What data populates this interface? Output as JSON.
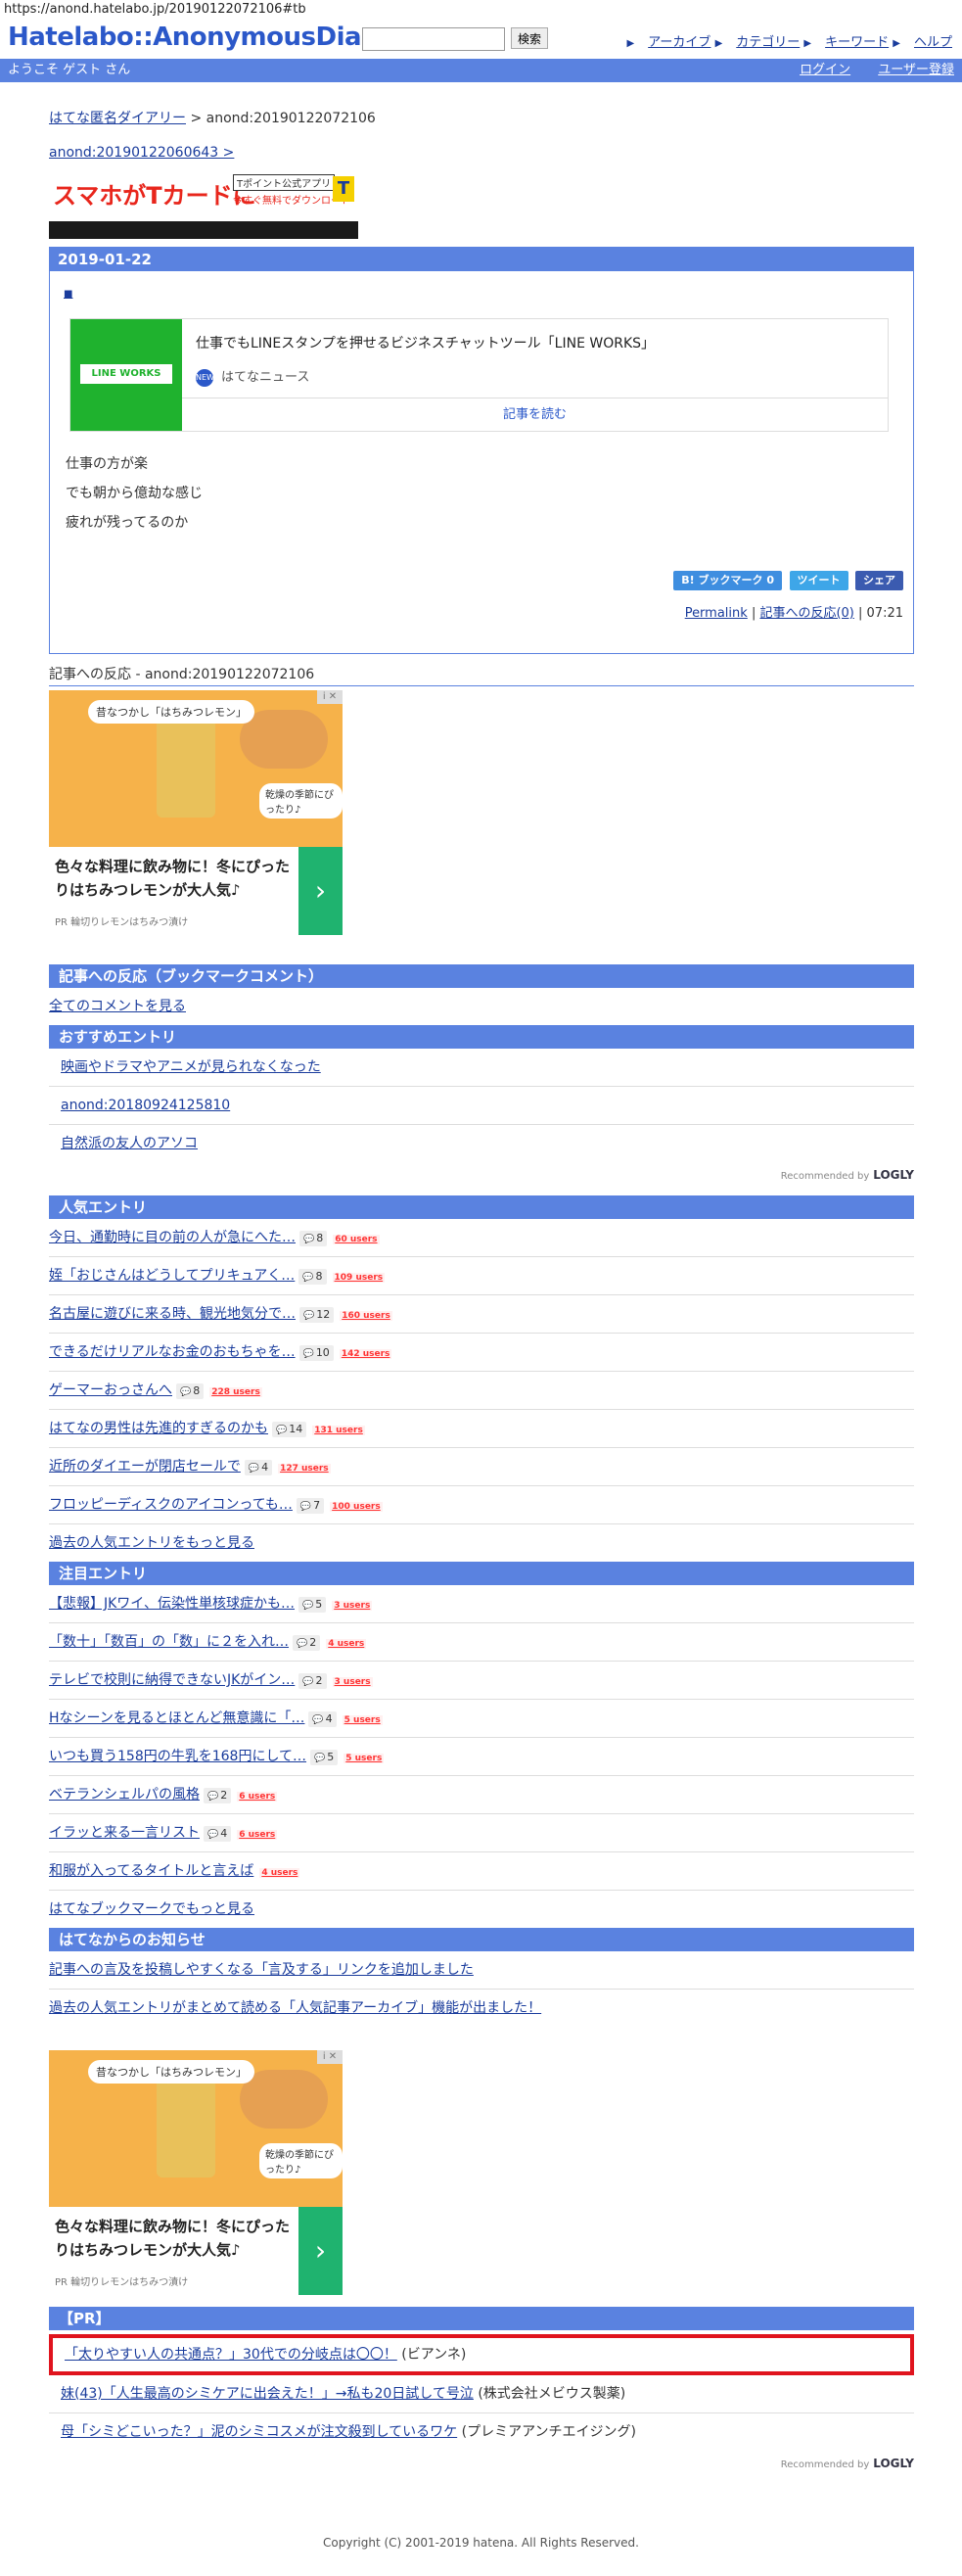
{
  "url": "https://anond.hatelabo.jp/20190122072106#tb",
  "header": {
    "logo": "Hatelabo::AnonymousDiary",
    "search_button": "検索",
    "links": [
      "アーカイブ",
      "カテゴリー",
      "キーワード",
      "ヘルプ"
    ]
  },
  "userbar": {
    "welcome": "ようこそ ゲスト さん",
    "login": "ログイン",
    "register": "ユーザー登録"
  },
  "breadcrumb": {
    "home": "はてな匿名ダイアリー",
    "current": " > anond:20190122072106"
  },
  "prev_link": "anond:20190122060643 >",
  "banner": {
    "text": "スマホがTカードに",
    "badge": "Tポイント公式アプリ",
    "badge2": "今すぐ無料でダウンロード",
    "tlogo": "T"
  },
  "entry": {
    "date": "2019-01-22",
    "small_link": "■",
    "card": {
      "thumb_text": "LINE WORKS",
      "title": "仕事でもLINEスタンプを押せるビジネスチャットツール「LINE WORKS」",
      "source": "はてなニュース",
      "source_icon": "NEW",
      "read": "記事を読む"
    },
    "lines": [
      "仕事の方が楽",
      "でも朝から億劫な感じ",
      "疲れが残ってるのか"
    ],
    "share": {
      "bookmark": "B! ブックマーク  0",
      "tweet": "ツイート",
      "facebook": "シェア"
    },
    "permalink": "Permalink",
    "reactions": "記事への反応(0)",
    "time": " | 07:21"
  },
  "response_title": "記事への反応 - anond:20190122072106",
  "ad": {
    "bubble1": "昔なつかし「はちみつレモン」",
    "bubble2": "乾燥の季節にぴったり♪",
    "text": "色々な料理に飲み物に！冬にぴったりはちみつレモンが大人気♪",
    "advertiser": "PR 輪切りレモンはちみつ漬け",
    "arrow": "›",
    "close": "i ✕"
  },
  "bookmark_section": {
    "title": "記事への反応（ブックマークコメント）",
    "all_comments": "全てのコメントを見る"
  },
  "recommended": {
    "title": "おすすめエントリ",
    "items": [
      "映画やドラマやアニメが見られなくなった",
      "anond:20180924125810",
      "自然派の友人のアソコ"
    ],
    "by": "Recommended by",
    "logo": "LOGLY"
  },
  "popular": {
    "title": "人気エントリ",
    "items": [
      {
        "title": "今日、通勤時に目の前の人が急にへた…",
        "comments": "8",
        "users": "60 users"
      },
      {
        "title": "姪「おじさんはどうしてプリキュアく…",
        "comments": "8",
        "users": "109 users"
      },
      {
        "title": "名古屋に遊びに来る時、観光地気分で…",
        "comments": "12",
        "users": "160 users"
      },
      {
        "title": "できるだけリアルなお金のおもちゃを…",
        "comments": "10",
        "users": "142 users"
      },
      {
        "title": "ゲーマーおっさんへ",
        "comments": "8",
        "users": "228 users"
      },
      {
        "title": "はてなの男性は先進的すぎるのかも",
        "comments": "14",
        "users": "131 users"
      },
      {
        "title": "近所のダイエーが閉店セールで",
        "comments": "4",
        "users": "127 users"
      },
      {
        "title": "フロッピーディスクのアイコンっても…",
        "comments": "7",
        "users": "100 users"
      }
    ],
    "more": "過去の人気エントリをもっと見る"
  },
  "attention": {
    "title": "注目エントリ",
    "items": [
      {
        "title": "【悲報】JKワイ、伝染性単核球症かも…",
        "comments": "5",
        "users": "3 users"
      },
      {
        "title": "「数十」「数百」の「数」に２を入れ…",
        "comments": "2",
        "users": "4 users"
      },
      {
        "title": "テレビで校則に納得できないJKがイン…",
        "comments": "2",
        "users": "3 users"
      },
      {
        "title": "Hなシーンを見るとほとんど無意識に「…",
        "comments": "4",
        "users": "5 users"
      },
      {
        "title": "いつも買う158円の牛乳を168円にして…",
        "comments": "5",
        "users": "5 users"
      },
      {
        "title": "ベテランシェルパの風格",
        "comments": "2",
        "users": "6 users"
      },
      {
        "title": "イラッと来る一言リスト",
        "comments": "4",
        "users": "6 users"
      },
      {
        "title": "和服が入ってるタイトルと言えば",
        "comments": "",
        "users": "4 users"
      }
    ],
    "more": "はてなブックマークでもっと見る"
  },
  "notices": {
    "title": "はてなからのお知らせ",
    "items": [
      "記事への言及を投稿しやすくなる「言及する」リンクを追加しました",
      "過去の人気エントリがまとめて読める「人気記事アーカイブ」機能が出ました！"
    ]
  },
  "pr": {
    "title": "【PR】",
    "items": [
      {
        "title": "「太りやすい人の共通点？」30代での分岐点は〇〇！",
        "sponsor": "(ビアンネ)"
      },
      {
        "title": "妹(43)「人生最高のシミケアに出会えた！」→私も20日試して号泣",
        "sponsor": "(株式会社メビウス製薬)"
      },
      {
        "title": "母「シミどこいった？」泥のシミコスメが注文殺到しているワケ",
        "sponsor": "(プレミアアンチエイジング)"
      }
    ],
    "by": "Recommended by",
    "logo": "LOGLY"
  },
  "copyright": "Copyright (C) 2001-2019 hatena. All Rights Reserved."
}
